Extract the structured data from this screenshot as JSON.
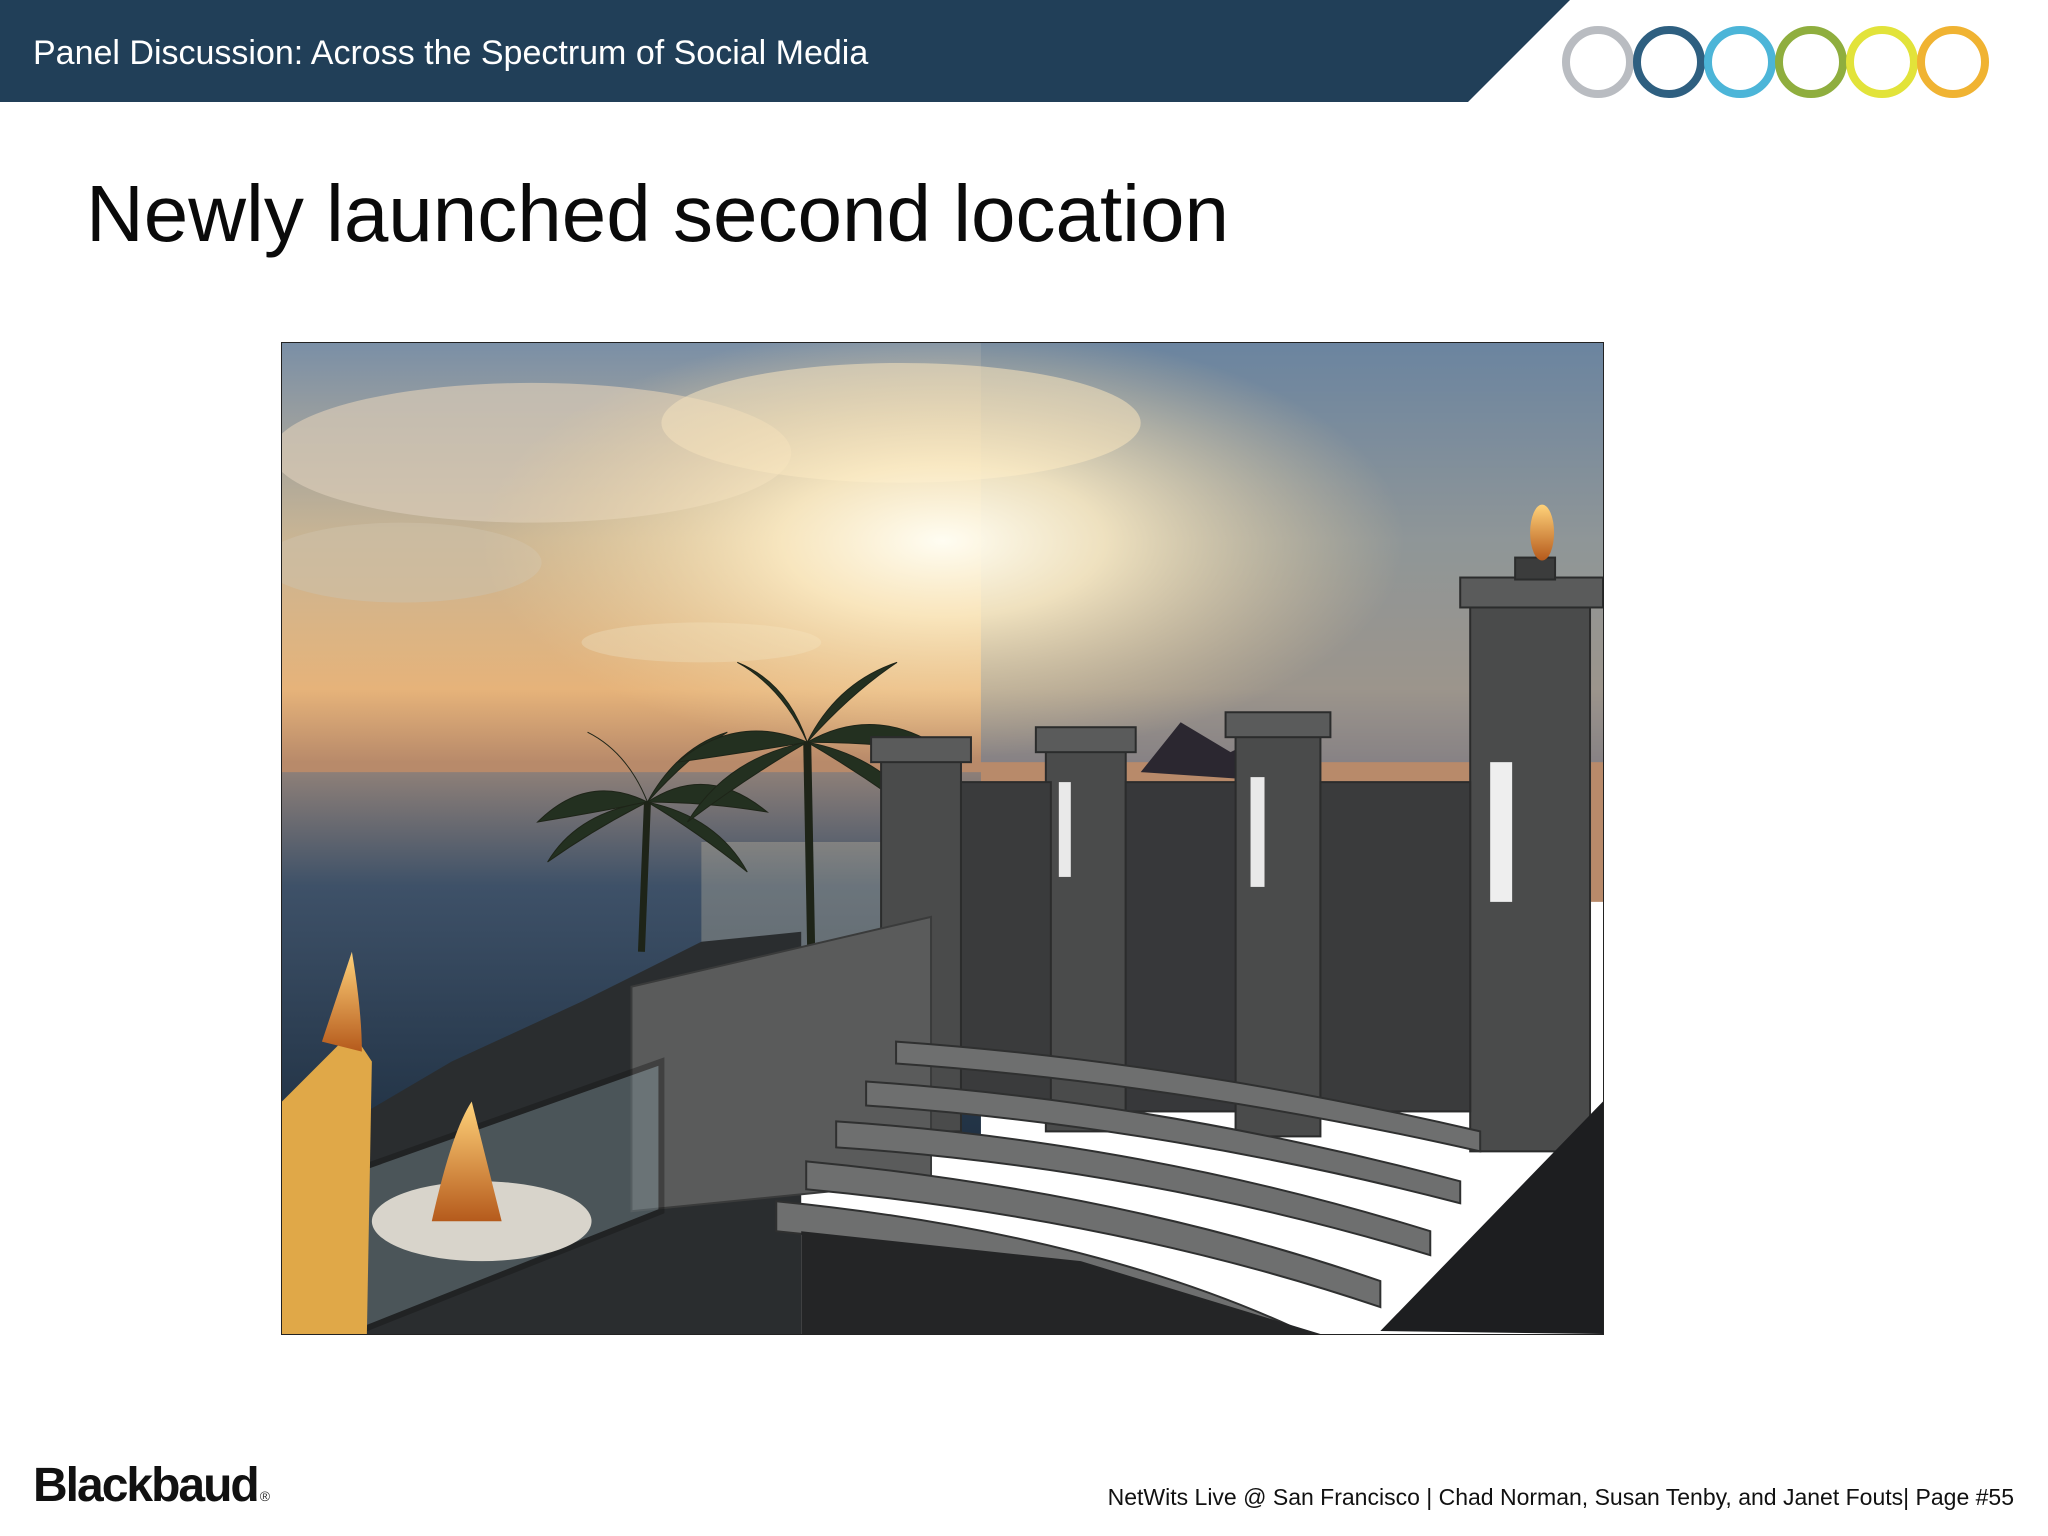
{
  "header": {
    "title": "Panel Discussion: Across the Spectrum of Social Media",
    "bar_color": "#213f58"
  },
  "brand_rings": {
    "colors": [
      "#b9bcc1",
      "#2e5f80",
      "#4cb5d8",
      "#8fae3e",
      "#e2e33a",
      "#f0b332"
    ]
  },
  "slide": {
    "title": "Newly launched second location"
  },
  "photo": {
    "description_icon": "virtual-world-amphitheater-image"
  },
  "footer": {
    "logo_text": "Blackbaud",
    "registered_mark": "®",
    "info": "NetWits Live @ San Francisco  |  Chad Norman, Susan Tenby, and Janet Fouts|  Page #55"
  }
}
